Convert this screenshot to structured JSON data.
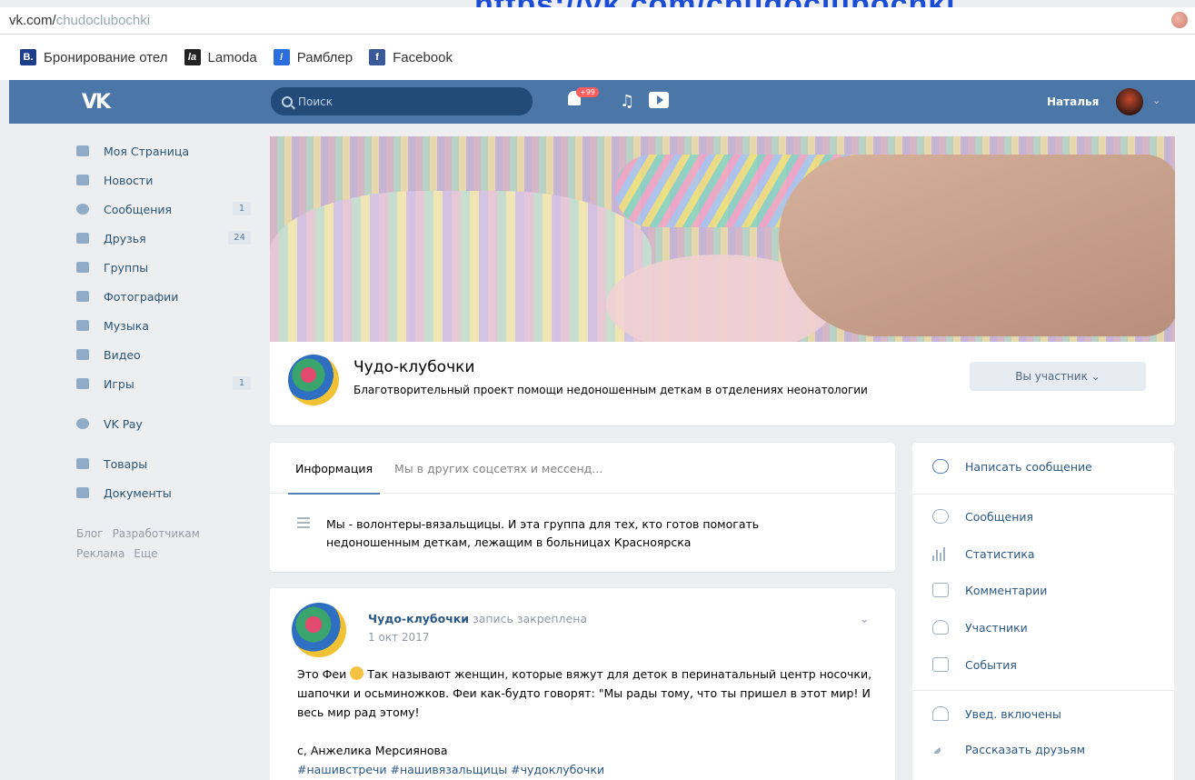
{
  "browser": {
    "overlay_link": "https://vk.com/chudoclubochki",
    "url_domain": "vk.com/",
    "url_path": "chudoclubochki"
  },
  "bookmarks": [
    {
      "icon": "B.",
      "label": "Бронирование отел",
      "color": "#1d3f8a"
    },
    {
      "icon": "la",
      "label": "Lamoda",
      "color": "#222222"
    },
    {
      "icon": "/",
      "label": "Рамблер",
      "color": "#2a6fdd"
    },
    {
      "icon": "f",
      "label": "Facebook",
      "color": "#3b5998"
    }
  ],
  "header": {
    "logo": "VK",
    "search_placeholder": "Поиск",
    "notifications_badge": "+99",
    "user_name": "Наталья",
    "accent_color": "#4a76a8"
  },
  "left_menu": {
    "items": [
      {
        "label": "Моя Страница",
        "icon": "home-icon"
      },
      {
        "label": "Новости",
        "icon": "news-icon"
      },
      {
        "label": "Сообщения",
        "icon": "messages-icon",
        "count": "1"
      },
      {
        "label": "Друзья",
        "icon": "friends-icon",
        "count": "24"
      },
      {
        "label": "Группы",
        "icon": "groups-icon"
      },
      {
        "label": "Фотографии",
        "icon": "photos-icon"
      },
      {
        "label": "Музыка",
        "icon": "music-icon"
      },
      {
        "label": "Видео",
        "icon": "video-icon"
      },
      {
        "label": "Игры",
        "icon": "games-icon",
        "count": "1"
      },
      {
        "label": "VK Pay",
        "icon": "vkpay-icon"
      },
      {
        "label": "Товары",
        "icon": "goods-icon"
      },
      {
        "label": "Документы",
        "icon": "documents-icon"
      }
    ],
    "footer_links": [
      "Блог",
      "Разработчикам",
      "Реклама",
      "Еще"
    ]
  },
  "group": {
    "name": "Чудо-клубочки",
    "description": "Благотворительный проект помощи недоношенным деткам в отделениях неонатологии",
    "member_button": "Вы участник"
  },
  "info": {
    "tabs": [
      "Информация",
      "Мы в других соцсетях и мессенд..."
    ],
    "active_tab": 0,
    "text": "Мы - волонтеры-вязальщицы. И эта группа для тех, кто готов помогать недоношенным деткам, лежащим в больницах Красноярска"
  },
  "post": {
    "author": "Чудо-клубочки",
    "pinned_label": "запись закреплена",
    "date": "1 окт 2017",
    "text_1": "Это Феи",
    "text_2": "Так называют женщин, которые вяжут для деток в перинатальный центр носочки, шапочки и осьминожков. Феи как-будто говорят: \"Мы рады тому, что ты пришел в этот мир! И весь мир рад этому!",
    "signature": "с, Анжелика Мерсиянова",
    "tags": "#нашивстречи #нашивязальщицы #чудоклубочки"
  },
  "actions": {
    "primary": "Написать сообщение",
    "items": [
      "Сообщения",
      "Статистика",
      "Комментарии",
      "Участники",
      "События"
    ],
    "secondary": [
      "Увед. включены",
      "Рассказать друзьям"
    ]
  }
}
